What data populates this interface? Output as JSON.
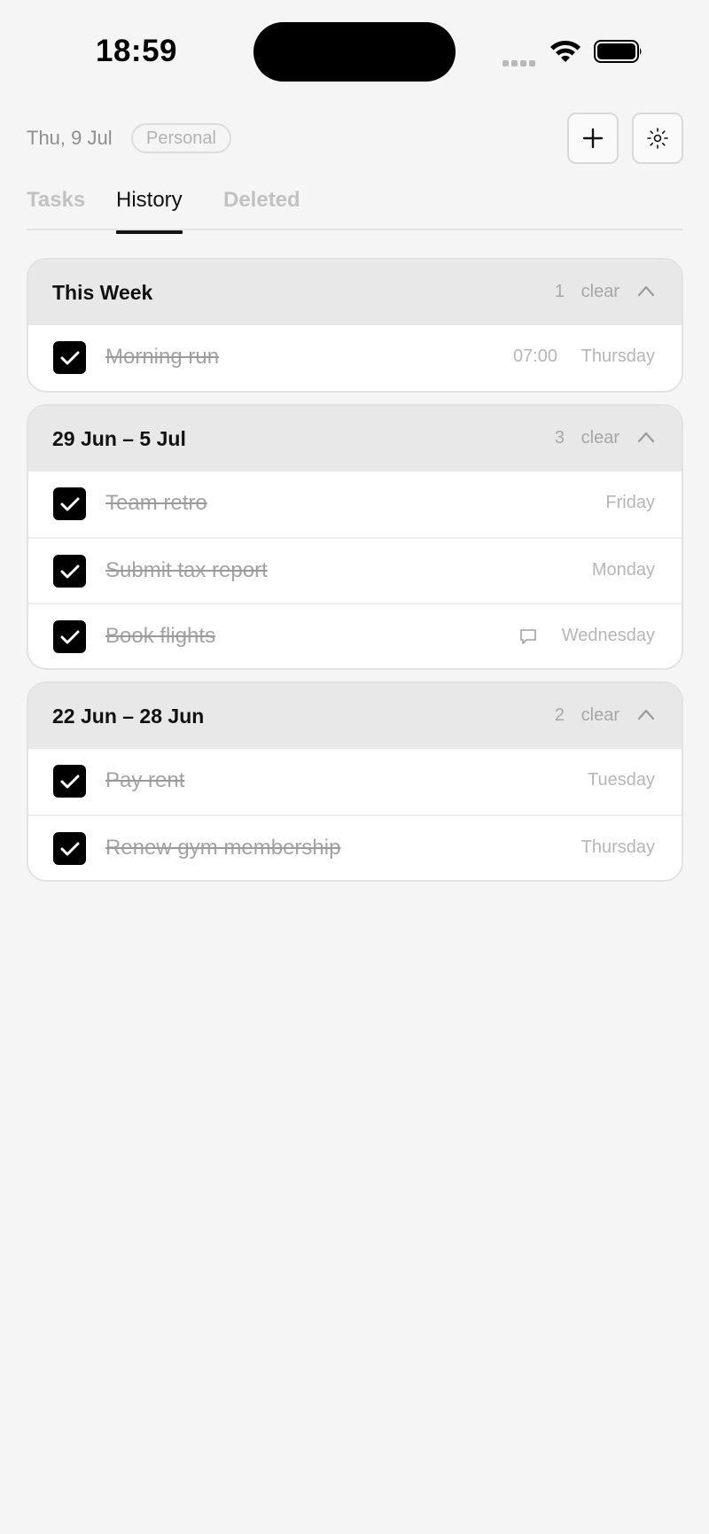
{
  "status_bar": {
    "time": "18:59"
  },
  "header": {
    "date": "Thu, 9 Jul",
    "badge": "Personal",
    "add_icon": "plus-icon",
    "settings_icon": "sun-icon"
  },
  "tabs": [
    {
      "label": "Tasks",
      "active": false
    },
    {
      "label": "History",
      "active": true
    },
    {
      "label": "Deleted",
      "active": false
    }
  ],
  "groups": [
    {
      "title": "This Week",
      "count": "1",
      "clear": "clear",
      "items": [
        {
          "text": "Morning run",
          "time": "07:00",
          "day": "Thursday",
          "done": true
        }
      ]
    },
    {
      "title": "29 Jun – 5 Jul",
      "count": "3",
      "clear": "clear",
      "items": [
        {
          "text": "Team retro",
          "day": "Friday",
          "done": true
        },
        {
          "text": "Submit tax report",
          "day": "Monday",
          "done": true
        },
        {
          "text": "Book flights",
          "day": "Wednesday",
          "has_comment": true,
          "done": true
        }
      ]
    },
    {
      "title": "22 Jun – 28 Jun",
      "count": "2",
      "clear": "clear",
      "items": [
        {
          "text": "Pay rent",
          "day": "Tuesday",
          "done": true
        },
        {
          "text": "Renew gym membership",
          "day": "Thursday",
          "done": true
        }
      ]
    }
  ]
}
